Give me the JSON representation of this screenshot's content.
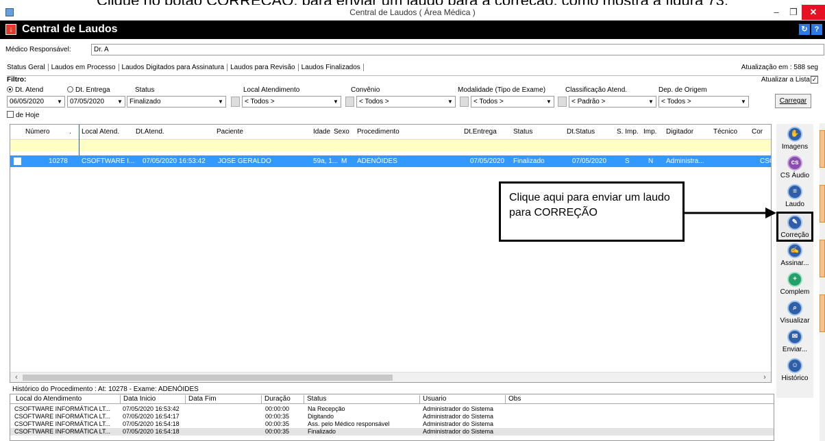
{
  "caption": "Clique no botão CORREÇÃO, para enviar um laudo para a correção, como mostra a figura 73.",
  "window": {
    "title": "Central de Laudos ( Área Médica )"
  },
  "app": {
    "title": "Central de Laudos"
  },
  "medico": {
    "label": "Médico Responsável:",
    "value": "Dr. A"
  },
  "tabs": [
    "Status Geral",
    "Laudos em Processo",
    "Laudos Digitados para Assinatura",
    "Laudos para Revisão",
    "Laudos Finalizados"
  ],
  "update_text": "Atualização em : 588 seg",
  "filter": {
    "legend": "Filtro:",
    "atualizar": "Atualizar a Lista",
    "atualizar_checked": true,
    "radio_atend": "Dt. Atend",
    "radio_entrega": "Dt. Entrega",
    "date_from": "06/05/2020",
    "date_to": "07/05/2020",
    "status_label": "Status",
    "status_value": "Finalizado",
    "local_label": "Local Atendimento",
    "local_value": "< Todos >",
    "convenio_label": "Convênio",
    "convenio_value": "< Todos >",
    "modalidade_label": "Modalidade (Tipo de Exame)",
    "modalidade_value": "< Todos >",
    "classificacao_label": "Classificação Atend.",
    "classificacao_value": "< Padrão >",
    "origem_label": "Dep. de Origem",
    "origem_value": "< Todos >",
    "de_hoje": "de Hoje",
    "carregar": "Carregar"
  },
  "grid": {
    "columns": [
      "Número",
      ".",
      "Local Atend.",
      "Dt.Atend.",
      "Paciente",
      "Idade",
      "Sexo",
      "Procedimento",
      "Dt.Entrega",
      "Status",
      "Dt.Status",
      "S. Imp.",
      "Imp.",
      "Digitador",
      "Técnico",
      "Cor"
    ],
    "row": [
      "10278",
      "CSOFTWARE I...",
      "07/05/2020 16:53:42",
      "JOSE GERALDO",
      "59a, 1...",
      "M",
      "ADENÓIDES",
      "07/05/2020",
      "Finalizado",
      "07/05/2020",
      "S",
      "N",
      "Administra...",
      "CSC"
    ]
  },
  "history": {
    "title": "Histórico do Procedimento : At: 10278 - Exame: ADENÓIDES",
    "columns": [
      "Local do Atendimento",
      "Data Inicio",
      "Data Fim",
      "Duração",
      "Status",
      "Usuario",
      "Obs"
    ],
    "rows": [
      [
        "CSOFTWARE INFORMÁTICA LT...",
        "07/05/2020 16:53:42",
        "",
        "00:00:00",
        "Na Recepção",
        "Administrador do Sistema"
      ],
      [
        "CSOFTWARE INFORMÁTICA LT...",
        "07/05/2020 16:54:17",
        "",
        "00:00:35",
        "Digitando",
        "Administrador do Sistema"
      ],
      [
        "CSOFTWARE INFORMÁTICA LT...",
        "07/05/2020 16:54:18",
        "",
        "00:00:35",
        "Ass. pelo Médico responsável",
        "Administrador do Sistema"
      ],
      [
        "CSOFTWARE INFORMÁTICA LT...",
        "07/05/2020 16:54:18",
        "",
        "00:00:35",
        "Finalizado",
        "Administrador do Sistema"
      ]
    ]
  },
  "toolbar": [
    {
      "label": "Imagens",
      "icon": "hand-icon"
    },
    {
      "label": "CS Áudio",
      "icon": "cs-audio-icon"
    },
    {
      "label": "Laudo",
      "icon": "document-icon"
    },
    {
      "label": "Correção",
      "icon": "correction-icon"
    },
    {
      "label": "Assinar...",
      "icon": "sign-icon"
    },
    {
      "label": "Complem",
      "icon": "complement-icon"
    },
    {
      "label": "Visualizar",
      "icon": "magnifier-icon"
    },
    {
      "label": "Enviar...",
      "icon": "envelope-icon"
    },
    {
      "label": "Histórico",
      "icon": "user-history-icon"
    }
  ],
  "callout": "Clique aqui para enviar um laudo para CORREÇÃO",
  "colors": {
    "accent": "#3399ff",
    "appbar": "#000000",
    "filter_row": "#ffffc4"
  }
}
